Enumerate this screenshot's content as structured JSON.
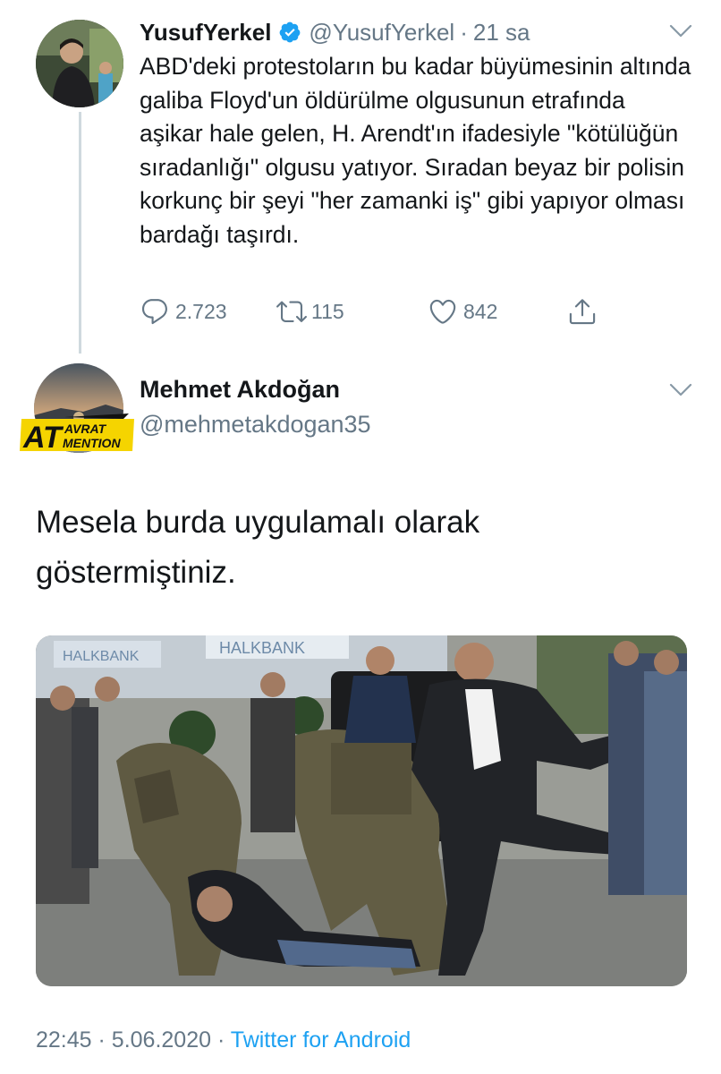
{
  "reply_tweet": {
    "display_name": "YusufYerkel",
    "handle": "@YusufYerkel",
    "time_ago": "21 sa",
    "text": "ABD'deki protestoların bu kadar büyümesinin altında galiba Floyd'un öldürülme olgusunun etrafında aşikar hale gelen, H. Arendt'ın ifadesiyle \"kötülüğün sıradanlığı\" olgusu yatıyor. Sıradan beyaz bir polisin korkunç bir şeyi \"her zamanki iş\" gibi yapıyor olması bardağı taşırdı.",
    "stats": {
      "replies": "2.723",
      "retweets": "115",
      "likes": "842"
    },
    "verified": true
  },
  "main_tweet": {
    "display_name": "Mehmet Akdoğan",
    "handle": "@mehmetakdogan35",
    "text": "Mesela burda uygulamalı olarak göstermiştiniz.",
    "image_signs": [
      "HALKBANK",
      "HALKBANK"
    ],
    "timestamp_time": "22:45",
    "timestamp_date": "5.06.2020",
    "source": "Twitter for Android"
  },
  "watermark": {
    "at": "AT",
    "line1": "AVRAT",
    "line2": "MENTION"
  },
  "icons": {
    "verified": "verified-badge-icon",
    "chevron": "chevron-down-icon",
    "reply": "reply-icon",
    "retweet": "retweet-icon",
    "like": "heart-icon",
    "share": "share-icon"
  },
  "colors": {
    "accent": "#1da1f2",
    "secondary_text": "#657786",
    "primary_text": "#14171a",
    "logo_yellow": "#f5d400"
  }
}
